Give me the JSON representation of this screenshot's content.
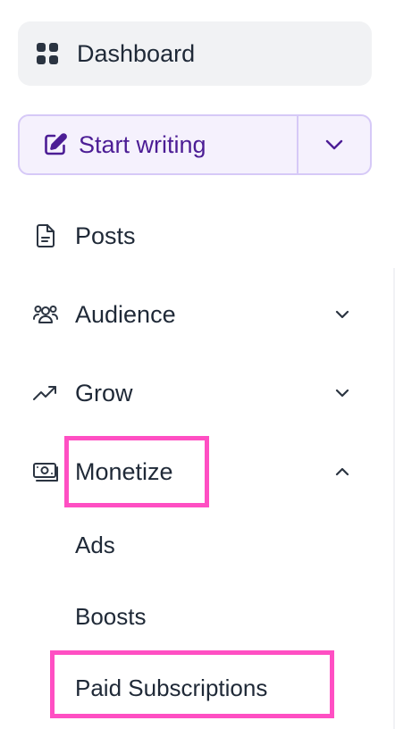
{
  "sidebar": {
    "dashboard": {
      "label": "Dashboard",
      "icon": "grid-icon"
    },
    "start_writing": {
      "label": "Start writing",
      "icon": "edit-icon",
      "dropdown_icon": "chevron-down-icon"
    },
    "items": [
      {
        "label": "Posts",
        "icon": "document-icon"
      },
      {
        "label": "Audience",
        "icon": "users-icon",
        "chevron": "chevron-down-icon"
      },
      {
        "label": "Grow",
        "icon": "trending-up-icon",
        "chevron": "chevron-down-icon"
      },
      {
        "label": "Monetize",
        "icon": "banknote-icon",
        "chevron": "chevron-up-icon",
        "expanded": true
      }
    ],
    "monetize_subitems": [
      {
        "label": "Ads"
      },
      {
        "label": "Boosts"
      },
      {
        "label": "Paid Subscriptions"
      }
    ]
  },
  "colors": {
    "accent": "#4c1d95",
    "accent_bg": "#f5f1fd",
    "accent_border": "#d6c9f7",
    "highlight": "#ff4fc3",
    "dashboard_bg": "#f1f2f4",
    "text": "#1f2937"
  }
}
